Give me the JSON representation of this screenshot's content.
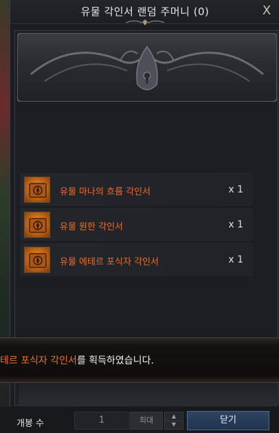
{
  "window": {
    "title": "유물 각인서 랜덤 주머니 (0)",
    "close_glyph": "X"
  },
  "items": [
    {
      "name": "유물 마나의 흐름 각인서",
      "qty": "x 1",
      "icon": "engraving-book-icon"
    },
    {
      "name": "유물 원한 각인서",
      "qty": "x 1",
      "icon": "engraving-book-icon"
    },
    {
      "name": "유물 에테르 포식자 각인서",
      "qty": "x 1",
      "icon": "engraving-book-icon"
    }
  ],
  "notice": {
    "highlight": "테르 포식자 각인서",
    "rest": "를 획득하였습니다."
  },
  "footer": {
    "open_count_label": "개봉 수",
    "count_value": "1",
    "max_label": "최대",
    "close_label": "닫기"
  },
  "colors": {
    "item_name": "#f06c2a",
    "close_button": "#2d4562"
  }
}
